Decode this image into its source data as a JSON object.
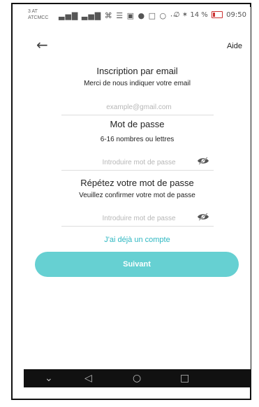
{
  "status": {
    "carrier_lines": [
      "3 AT",
      "ATCMCC"
    ],
    "icons": "▃▅▇  ▃▅▇  ⌘  ☰  ▣  ●  □  ○  ⋯",
    "right_icons": "∅ ✶",
    "battery_text": "14 %",
    "time": "09:50"
  },
  "header": {
    "back_icon": "←",
    "help_label": "Aide"
  },
  "form": {
    "email_title": "Inscription par email",
    "email_subtitle": "Merci de nous indiquer votre email",
    "email_placeholder": "example@gmail.com",
    "password_title": "Mot de passe",
    "password_subtitle": "6-16 nombres ou lettres",
    "password_placeholder": "Introduire mot de passe",
    "confirm_title": "Répétez votre mot de passe",
    "confirm_subtitle": "Veuillez confirmer votre mot de passe",
    "confirm_placeholder": "Introduire mot de passe"
  },
  "links": {
    "have_account": "J'ai déjà un compte"
  },
  "buttons": {
    "next_label": "Suivant"
  },
  "navbar": {
    "down": "⌄",
    "back": "◁",
    "home": "○",
    "recent": "□"
  },
  "colors": {
    "accent": "#66d0d2",
    "link": "#2fb8c2",
    "nav_background": "#111111"
  }
}
